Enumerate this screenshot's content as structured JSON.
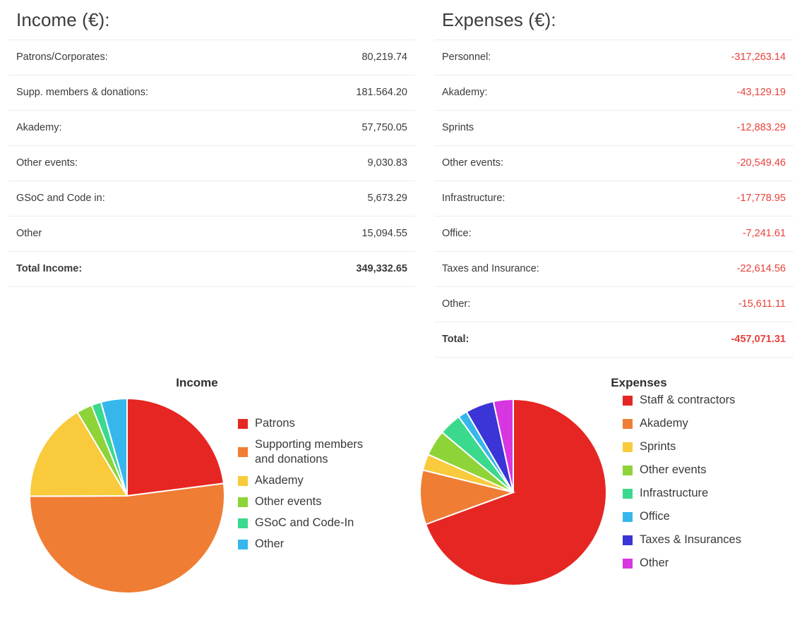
{
  "income_section": {
    "title": "Income (€):",
    "rows": [
      {
        "label": "Patrons/Corporates:",
        "value": "80,219.74"
      },
      {
        "label": "Supp. members & donations:",
        "value": "181.564.20"
      },
      {
        "label": "Akademy:",
        "value": "57,750.05"
      },
      {
        "label": "Other events:",
        "value": "9,030.83"
      },
      {
        "label": "GSoC and Code in:",
        "value": "5,673.29"
      },
      {
        "label": "Other",
        "value": "15,094.55"
      }
    ],
    "total": {
      "label": "Total Income:",
      "value": "349,332.65"
    }
  },
  "expenses_section": {
    "title": "Expenses (€):",
    "rows": [
      {
        "label": "Personnel:",
        "value": "-317,263.14"
      },
      {
        "label": "Akademy:",
        "value": "-43,129.19"
      },
      {
        "label": "Sprints",
        "value": "-12,883.29"
      },
      {
        "label": "Other events:",
        "value": "-20,549.46"
      },
      {
        "label": "Infrastructure:",
        "value": "-17,778.95"
      },
      {
        "label": "Office:",
        "value": "-7,241.61"
      },
      {
        "label": "Taxes and Insurance:",
        "value": "-22,614.56"
      },
      {
        "label": "Other:",
        "value": "-15,611.11"
      }
    ],
    "total": {
      "label": "Total:",
      "value": "-457,071.31"
    },
    "negative_color": "#e8413a"
  },
  "chart_data": [
    {
      "type": "pie",
      "title": "Income",
      "legend_position": "right",
      "categories": [
        "Patrons",
        "Supporting members\nand donations",
        "Akademy",
        "Other events",
        "GSoC and Code-In",
        "Other"
      ],
      "values": [
        80219.74,
        181564.2,
        57750.05,
        9030.83,
        5673.29,
        15094.55
      ],
      "colors": [
        "#e62622",
        "#ef7d34",
        "#f9ca3c",
        "#8ed338",
        "#3bd98d",
        "#36b7ec"
      ],
      "total": 349332.66,
      "start_angle_deg": 0,
      "direction": "clockwise"
    },
    {
      "type": "pie",
      "title": "Expenses",
      "legend_position": "right",
      "categories": [
        "Staff & contractors",
        "Akademy",
        "Sprints",
        "Other events",
        "Infrastructure",
        "Office",
        "Taxes & Insurances",
        "Other"
      ],
      "values": [
        317263.14,
        43129.19,
        12883.29,
        20549.46,
        17778.95,
        7241.61,
        22614.56,
        15611.11
      ],
      "colors": [
        "#e62622",
        "#ef7d34",
        "#f9ca3c",
        "#8ed338",
        "#3bd98d",
        "#36b7ec",
        "#3b34d6",
        "#d836e0"
      ],
      "total": 457071.31,
      "start_angle_deg": 0,
      "direction": "clockwise"
    }
  ]
}
